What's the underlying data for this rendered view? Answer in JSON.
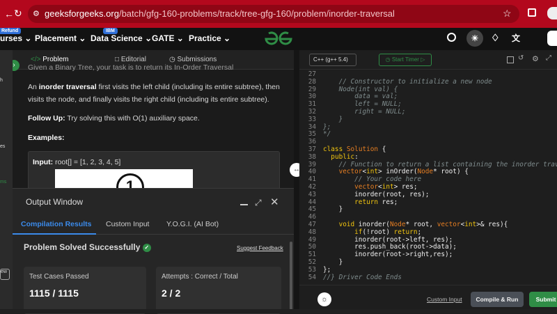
{
  "browser": {
    "url_host": "geeksforgeeks.org",
    "url_path": "/batch/gfg-160-problems/track/tree-gfg-160/problem/inorder-traversal"
  },
  "nav": {
    "refund_tag": "Refund",
    "ibm_tag": "IBM",
    "courses": "urses",
    "placement": "Placement",
    "datascience": "Data Science",
    "gate": "GATE",
    "practice": "Practice",
    "logo": "GfG"
  },
  "sidebar": {
    "item1": "h",
    "item2": "es",
    "item3": "ms",
    "item4": "ew"
  },
  "tabs": {
    "problem": "Problem",
    "editorial": "Editorial",
    "submissions": "Submissions"
  },
  "problem": {
    "cut_line": "Given a Binary Tree, your task is to return its In-Order Traversal",
    "p1_a": "An ",
    "p1_bold": "inorder traversal",
    "p1_b": " first visits the left child (including its entire subtree), then",
    "p1_c": "visits the node, and finally visits the right child (including its entire subtree).",
    "followup_label": "Follow Up:",
    "followup_text": " Try solving this with O(1) auxiliary space.",
    "examples": "Examples:",
    "input_label": "Input:",
    "input_value": "root[] = [1, 2, 3, 4, 5]",
    "node_value": "1"
  },
  "output": {
    "title": "Output Window",
    "tabs": [
      "Compilation Results",
      "Custom Input",
      "Y.O.G.I. (AI Bot)"
    ],
    "status": "Problem Solved Successfully",
    "feedback": "Suggest Feedback",
    "tc_label": "Test Cases Passed",
    "tc_value": "1115 / 1115",
    "att_label": "Attempts : Correct / Total",
    "att_value": "2 / 2"
  },
  "editor": {
    "language": "C++ (g++ 5.4)",
    "timer": "Start Timer",
    "custom_input": "Custom Input",
    "compile": "Compile & Run",
    "submit": "Submit"
  },
  "code": [
    {
      "n": "27",
      "t": ""
    },
    {
      "n": "28",
      "t": "    // Constructor to initialize a new node"
    },
    {
      "n": "29",
      "t": "    Node(int val) {"
    },
    {
      "n": "30",
      "t": "        data = val;"
    },
    {
      "n": "31",
      "t": "        left = NULL;"
    },
    {
      "n": "32",
      "t": "        right = NULL;"
    },
    {
      "n": "33",
      "t": "    }"
    },
    {
      "n": "34",
      "t": "};"
    },
    {
      "n": "35",
      "t": "*/"
    },
    {
      "n": "36",
      "t": ""
    },
    {
      "n": "37",
      "t": "class Solution {"
    },
    {
      "n": "38",
      "t": "  public:"
    },
    {
      "n": "39",
      "t": "    // Function to return a list containing the inorder traversal"
    },
    {
      "n": "40",
      "t": "    vector<int> inOrder(Node* root) {"
    },
    {
      "n": "41",
      "t": "        // Your code here"
    },
    {
      "n": "42",
      "t": "        vector<int> res;"
    },
    {
      "n": "43",
      "t": "        inorder(root, res);"
    },
    {
      "n": "44",
      "t": "        return res;"
    },
    {
      "n": "45",
      "t": "    }"
    },
    {
      "n": "46",
      "t": ""
    },
    {
      "n": "47",
      "t": "    void inorder(Node* root, vector<int>& res){"
    },
    {
      "n": "48",
      "t": "        if(!root) return;"
    },
    {
      "n": "49",
      "t": "        inorder(root->left, res);"
    },
    {
      "n": "50",
      "t": "        res.push_back(root->data);"
    },
    {
      "n": "51",
      "t": "        inorder(root->right,res);"
    },
    {
      "n": "52",
      "t": "    }"
    },
    {
      "n": "53",
      "t": "};"
    },
    {
      "n": "54",
      "t": "//} Driver Code Ends"
    }
  ],
  "colors": {
    "brand": "#2f8d46",
    "chrome": "#b3081d",
    "success": "#2f8d46"
  }
}
